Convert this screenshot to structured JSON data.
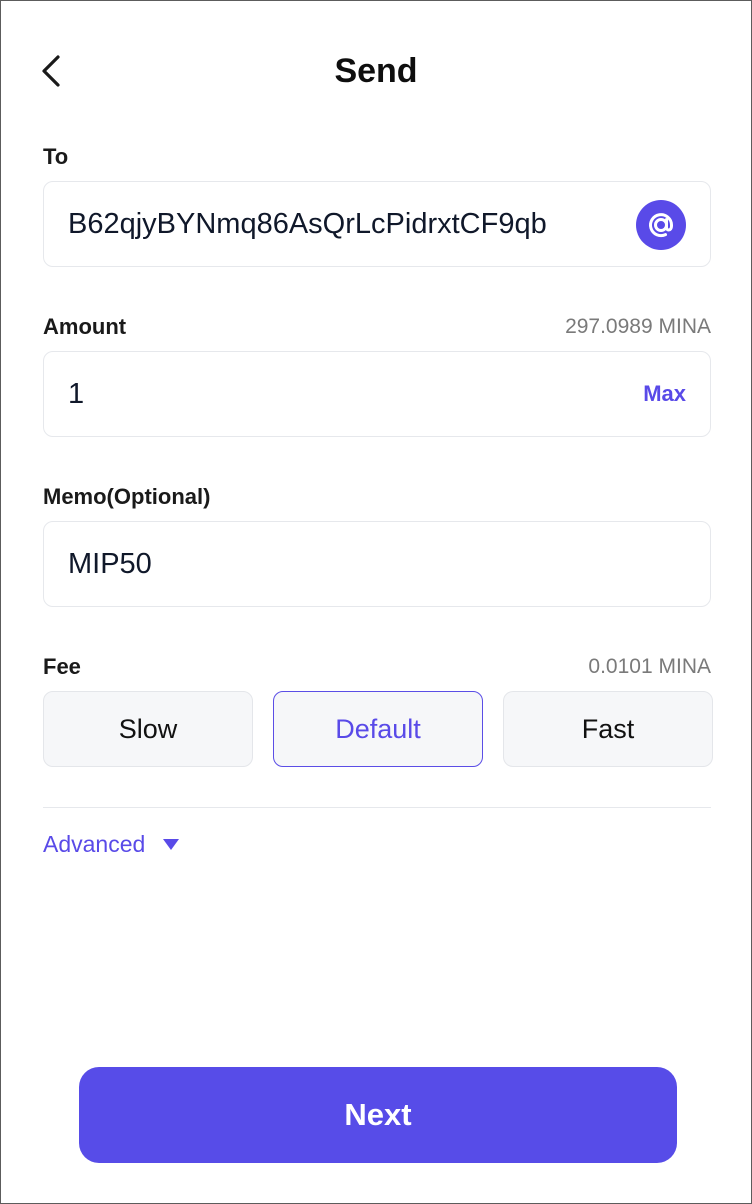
{
  "header": {
    "title": "Send",
    "back_icon": "chevron-left-icon"
  },
  "to": {
    "label": "To",
    "value": "B62qjyBYNmq86AsQrLcPidrxtCF9qb",
    "address_book_icon": "at-sign-icon"
  },
  "amount": {
    "label": "Amount",
    "balance": "297.0989 MINA",
    "value": "1",
    "max_label": "Max"
  },
  "memo": {
    "label": "Memo(Optional)",
    "value": "MIP50"
  },
  "fee": {
    "label": "Fee",
    "amount": "0.0101 MINA",
    "options": [
      "Slow",
      "Default",
      "Fast"
    ],
    "selected": "Default"
  },
  "advanced": {
    "label": "Advanced",
    "icon": "caret-down-icon"
  },
  "footer": {
    "next_label": "Next"
  },
  "colors": {
    "accent": "#594ae8",
    "text": "#111111",
    "muted": "#7a7a7a",
    "border": "#e6e8ec",
    "button_bg": "#f6f7f9"
  }
}
